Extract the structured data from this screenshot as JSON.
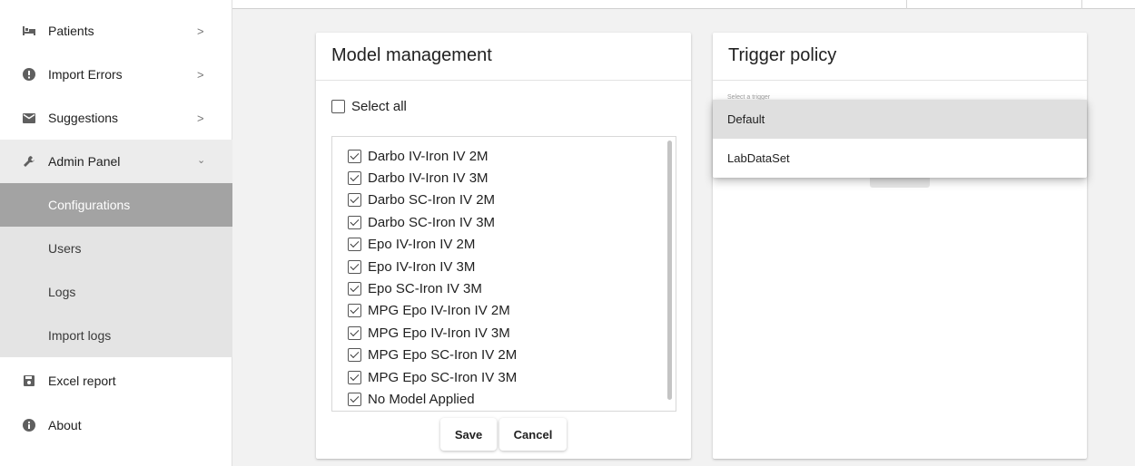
{
  "sidebar": {
    "items": [
      {
        "label": "Patients",
        "icon": "bed-icon",
        "chevron": ">"
      },
      {
        "label": "Import Errors",
        "icon": "error-icon",
        "chevron": ">"
      },
      {
        "label": "Suggestions",
        "icon": "mail-icon",
        "chevron": ">"
      },
      {
        "label": "Admin Panel",
        "icon": "wrench-icon",
        "chevron": "⌄"
      }
    ],
    "subitems": [
      {
        "label": "Configurations",
        "active": true
      },
      {
        "label": "Users"
      },
      {
        "label": "Logs"
      },
      {
        "label": "Import logs"
      }
    ],
    "bottom_items": [
      {
        "label": "Excel report",
        "icon": "save-icon"
      },
      {
        "label": "About",
        "icon": "info-icon"
      }
    ]
  },
  "model_management": {
    "title": "Model management",
    "select_all_label": "Select all",
    "models": [
      {
        "label": "Darbo IV-Iron IV 2M",
        "checked": true
      },
      {
        "label": "Darbo IV-Iron IV 3M",
        "checked": true
      },
      {
        "label": "Darbo SC-Iron IV 2M",
        "checked": true
      },
      {
        "label": "Darbo SC-Iron IV 3M",
        "checked": true
      },
      {
        "label": "Epo IV-Iron IV 2M",
        "checked": true
      },
      {
        "label": "Epo IV-Iron IV 3M",
        "checked": true
      },
      {
        "label": "Epo SC-Iron IV 3M",
        "checked": true
      },
      {
        "label": "MPG Epo IV-Iron IV 2M",
        "checked": true
      },
      {
        "label": "MPG Epo IV-Iron IV 3M",
        "checked": true
      },
      {
        "label": "MPG Epo SC-Iron IV 2M",
        "checked": true
      },
      {
        "label": "MPG Epo SC-Iron IV 3M",
        "checked": true
      },
      {
        "label": "No Model Applied",
        "checked": true
      }
    ],
    "save_label": "Save",
    "cancel_label": "Cancel"
  },
  "trigger_policy": {
    "title": "Trigger policy",
    "select_label": "Select a trigger",
    "options": [
      "Default",
      "LabDataSet"
    ],
    "selected": "Default"
  },
  "colors": {
    "active_nav": "#a3a3a3",
    "submenu_bg": "#e4e4e4",
    "selected_option": "#dfdfdf"
  }
}
